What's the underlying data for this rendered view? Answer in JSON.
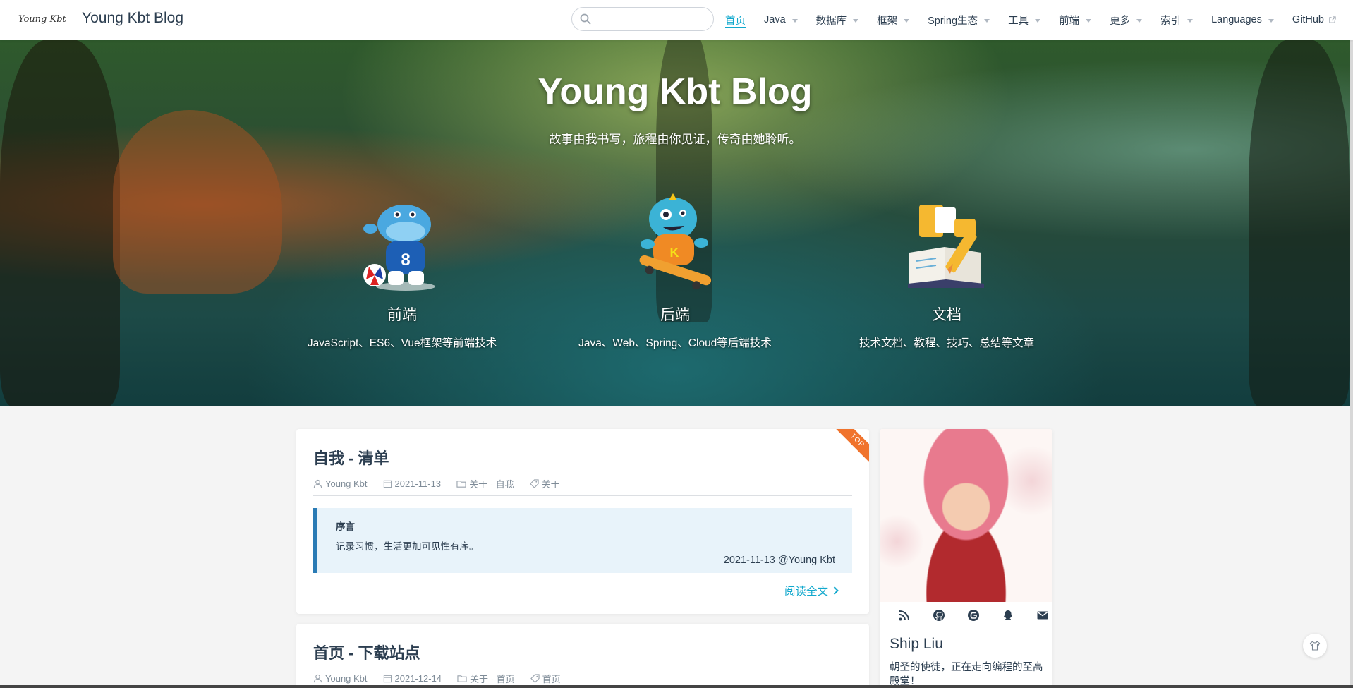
{
  "navbar": {
    "logo_alt": "Young Kbt",
    "site_name": "Young Kbt Blog",
    "search_placeholder": "",
    "items": [
      {
        "label": "首页",
        "dropdown": false,
        "active": true
      },
      {
        "label": "Java",
        "dropdown": true
      },
      {
        "label": "数据库",
        "dropdown": true
      },
      {
        "label": "框架",
        "dropdown": true
      },
      {
        "label": "Spring生态",
        "dropdown": true
      },
      {
        "label": "工具",
        "dropdown": true
      },
      {
        "label": "前端",
        "dropdown": true
      },
      {
        "label": "更多",
        "dropdown": true
      },
      {
        "label": "索引",
        "dropdown": true
      },
      {
        "label": "Languages",
        "dropdown": true
      },
      {
        "label": "GitHub",
        "external": true
      }
    ]
  },
  "hero": {
    "title": "Young Kbt Blog",
    "description": "故事由我书写，旅程由你见证，传奇由她聆听。",
    "features": [
      {
        "title": "前端",
        "desc": "JavaScript、ES6、Vue框架等前端技术",
        "icon": "hippo-football-icon"
      },
      {
        "title": "后端",
        "desc": "Java、Web、Spring、Cloud等后端技术",
        "icon": "monster-skateboard-icon"
      },
      {
        "title": "文档",
        "desc": "技术文档、教程、技巧、总结等文章",
        "icon": "book-pencil-icon"
      }
    ]
  },
  "posts": [
    {
      "title": "自我 - 清单",
      "sticky_label": "TOP",
      "author": "Young Kbt",
      "date": "2021-11-13",
      "category": "关于 - 自我",
      "tag": "关于",
      "tip_title": "序言",
      "tip_text": "记录习惯，生活更加可见性有序。",
      "tip_sign": "2021-11-13 @Young Kbt",
      "read_more": "阅读全文"
    },
    {
      "title": "首页 - 下载站点",
      "author": "Young Kbt",
      "date": "2021-12-14",
      "category": "关于 - 首页",
      "tag": "首页"
    }
  ],
  "blogger": {
    "name": "Ship Liu",
    "slogan": "朝圣的使徒，正在走向编程的至高殿堂！",
    "social_icons": [
      "rss-icon",
      "github-icon",
      "gitee-icon",
      "qq-icon",
      "email-icon"
    ]
  },
  "colors": {
    "accent": "#11a8cd",
    "tip_border": "#2a7bb5",
    "tip_bg": "#e8f3fa",
    "ribbon": "#f0732c"
  }
}
